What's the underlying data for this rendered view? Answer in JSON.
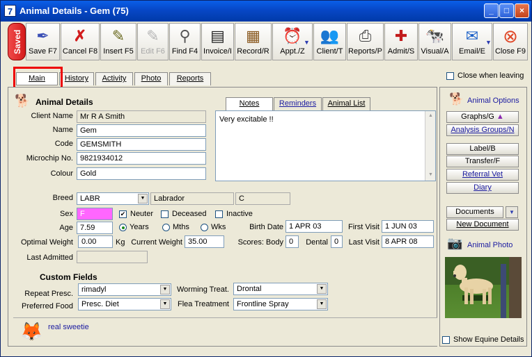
{
  "window": {
    "app_icon": "7",
    "title": "Animal Details - Gem (75)"
  },
  "toolbar": {
    "saved": "Saved",
    "buttons": [
      {
        "label": "Save F7",
        "icon": "quill-pen-icon"
      },
      {
        "label": "Cancel F8",
        "icon": "red-x-icon"
      },
      {
        "label": "Insert F5",
        "icon": "insert-pencil-icon"
      },
      {
        "label": "Edit F6",
        "icon": "edit-pencil-icon"
      },
      {
        "label": "Find F4",
        "icon": "magnifier-icon"
      },
      {
        "label": "Invoice/I",
        "icon": "invoice-icon"
      },
      {
        "label": "Record/R",
        "icon": "record-files-icon"
      },
      {
        "label": "Appt./Z",
        "icon": "alarm-clock-icon"
      },
      {
        "label": "Client/T",
        "icon": "people-icon"
      },
      {
        "label": "Reports/P",
        "icon": "printer-icon"
      },
      {
        "label": "Admit/S",
        "icon": "medical-admit-icon"
      },
      {
        "label": "Visual/A",
        "icon": "cow-icon"
      },
      {
        "label": "Email/E",
        "icon": "email-icon"
      },
      {
        "label": "Close F9",
        "icon": "close-circle-icon"
      }
    ]
  },
  "tabs": [
    "Main",
    "History",
    "Activity",
    "Photo",
    "Reports"
  ],
  "close_when_leaving": "Close when leaving",
  "animal_details": {
    "heading": "Animal Details",
    "client_name_label": "Client Name",
    "client_name": "Mr R A Smith",
    "name_label": "Name",
    "name": "Gem",
    "code_label": "Code",
    "code": "GEMSMITH",
    "microchip_label": "Microchip No.",
    "microchip": "9821934012",
    "colour_label": "Colour",
    "colour": "Gold",
    "breed_label": "Breed",
    "breed_code": "LABR",
    "breed_name": "Labrador",
    "breed_extra": "C",
    "sex_label": "Sex",
    "sex": "F",
    "neuter_label": "Neuter",
    "deceased_label": "Deceased",
    "inactive_label": "Inactive",
    "age_label": "Age",
    "age": "7.59",
    "years_label": "Years",
    "mths_label": "Mths",
    "wks_label": "Wks",
    "birth_date_label": "Birth Date",
    "birth_date": "1 APR 03",
    "first_visit_label": "First Visit",
    "first_visit": "1 JUN 03",
    "optimal_weight_label": "Optimal Weight",
    "optimal_weight": "0.00",
    "kg": "Kg",
    "current_weight_label": "Current Weight",
    "current_weight": "35.00",
    "scores_body_label": "Scores: Body",
    "scores_body": "0",
    "dental_label": "Dental",
    "dental": "0",
    "last_visit_label": "Last Visit",
    "last_visit": "8 APR 08",
    "last_admitted_label": "Last Admitted",
    "last_admitted": ""
  },
  "notes": {
    "tabs": [
      "Notes",
      "Reminders",
      "Animal List"
    ],
    "text": "Very excitable !!"
  },
  "custom_fields": {
    "heading": "Custom Fields",
    "repeat_presc_label": "Repeat Presc.",
    "repeat_presc": "rimadyl",
    "preferred_food_label": "Preferred Food",
    "preferred_food": "Presc. Diet",
    "worming_label": "Worming Treat.",
    "worming": "Drontal",
    "flea_label": "Flea Treatment",
    "flea": "Frontline Spray"
  },
  "bottom": {
    "note": "real sweetie"
  },
  "side": {
    "animal_options": "Animal Options",
    "graphs": "Graphs/G",
    "analysis_groups": "Analysis Groups/N",
    "label": "Label/B",
    "transfer": "Transfer/F",
    "referral_vet": "Referral Vet",
    "diary": "Diary",
    "documents": "Documents",
    "new_document": "New Document",
    "animal_photo": "Animal Photo",
    "show_equine": "Show Equine Details"
  },
  "colors": {
    "sex_field": "#ff66ff",
    "title_bar": "#0747c6",
    "highlight": "#ee0000"
  }
}
